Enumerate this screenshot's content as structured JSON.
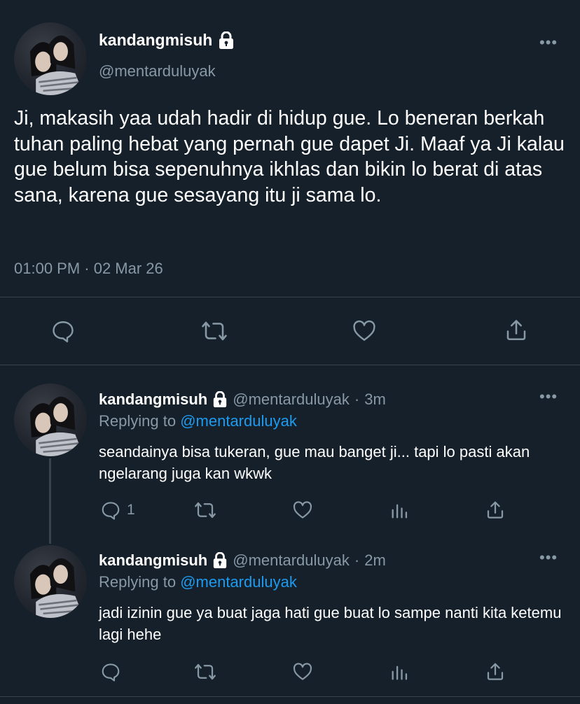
{
  "main_tweet": {
    "display_name": "kandangmisuh",
    "handle": "@mentarduluyak",
    "text": "Ji, makasih yaa udah hadir di hidup gue. Lo beneran berkah tuhan paling hebat yang pernah gue dapet Ji. Maaf ya Ji kalau gue belum bisa sepenuhnya ikhlas dan bikin lo berat di atas sana, karena gue sesayang itu ji sama lo.",
    "timestamp": "01:00 PM · 02 Mar 26",
    "more_icon": "more-horizontal-icon",
    "actions": [
      "reply-icon",
      "retweet-icon",
      "like-icon",
      "share-icon"
    ]
  },
  "replies": [
    {
      "display_name": "kandangmisuh",
      "handle": "@mentarduluyak",
      "separator": "·",
      "time": "3m",
      "replying_prefix": "Replying to",
      "replying_to": "@mentarduluyak",
      "text": "seandainya bisa tukeran, gue mau banget ji... tapi lo pasti akan ngelarang juga kan wkwk",
      "reply_count": "1"
    },
    {
      "display_name": "kandangmisuh",
      "handle": "@mentarduluyak",
      "separator": "·",
      "time": "2m",
      "replying_prefix": "Replying to",
      "replying_to": "@mentarduluyak",
      "text": "jadi izinin gue ya buat jaga hati gue buat lo sampe nanti kita ketemu lagi hehe",
      "reply_count": ""
    }
  ],
  "colors": {
    "background": "#15202b",
    "text": "#ffffff",
    "muted": "#8899a6",
    "link": "#1d9bf0",
    "divider": "#38444d"
  }
}
